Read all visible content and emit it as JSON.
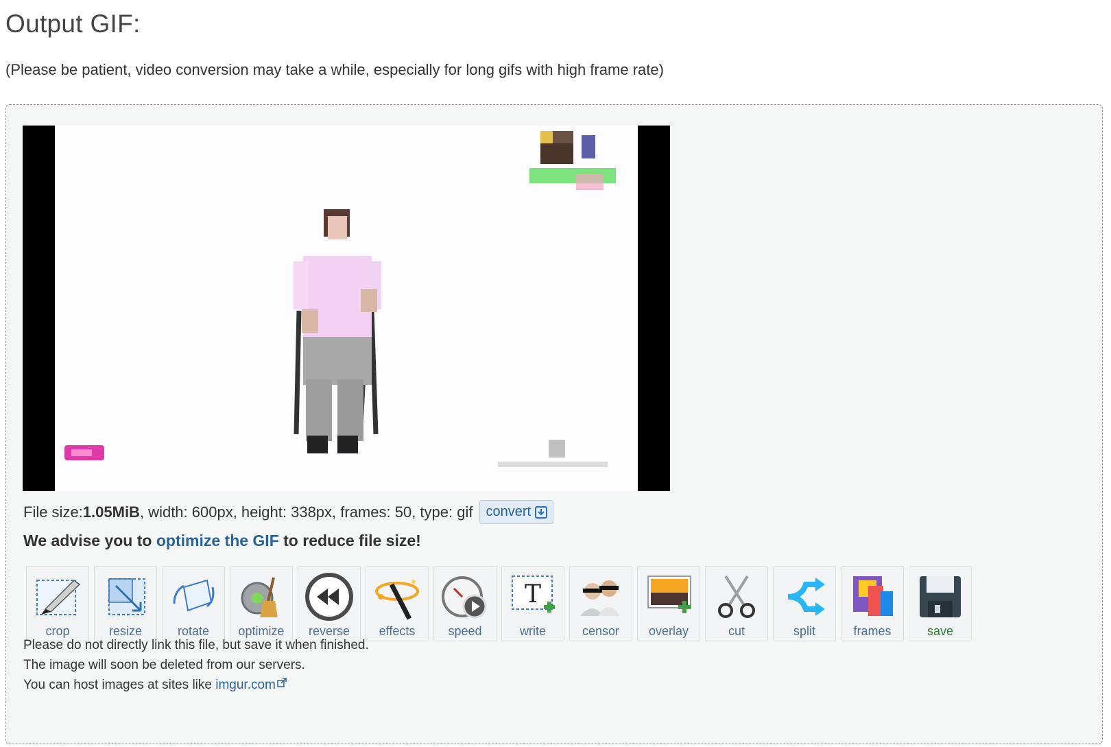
{
  "page": {
    "title": "Output GIF:",
    "subtitle": "(Please be patient, video conversion may take a while, especially for long gifs with high frame rate)"
  },
  "file_info": {
    "size_label": "File size: ",
    "size_value": "1.05MiB",
    "details": ", width: 600px, height: 338px, frames: 50, type: gif",
    "convert_label": "convert"
  },
  "advice": {
    "prefix": "We advise you to ",
    "link": "optimize the GIF",
    "suffix": " to reduce file size!"
  },
  "tools": [
    {
      "label": "crop",
      "icon": "crop-icon"
    },
    {
      "label": "resize",
      "icon": "resize-icon"
    },
    {
      "label": "rotate",
      "icon": "rotate-icon"
    },
    {
      "label": "optimize",
      "icon": "optimize-icon"
    },
    {
      "label": "reverse",
      "icon": "reverse-icon"
    },
    {
      "label": "effects",
      "icon": "effects-icon"
    },
    {
      "label": "speed",
      "icon": "speed-icon"
    },
    {
      "label": "write",
      "icon": "write-icon"
    },
    {
      "label": "censor",
      "icon": "censor-icon"
    },
    {
      "label": "overlay",
      "icon": "overlay-icon"
    },
    {
      "label": "cut",
      "icon": "cut-icon"
    },
    {
      "label": "split",
      "icon": "split-icon"
    },
    {
      "label": "frames",
      "icon": "frames-icon"
    },
    {
      "label": "save",
      "icon": "save-icon"
    }
  ],
  "notes": {
    "line1": "Please do not directly link this file, but save it when finished.",
    "line2": "The image will soon be deleted from our servers.",
    "line3_prefix": "You can host images at sites like ",
    "line3_link": "imgur.com"
  },
  "colors": {
    "link": "#2a6496",
    "panel_bg": "#f5f6f6",
    "save_label": "#2e7d32"
  }
}
